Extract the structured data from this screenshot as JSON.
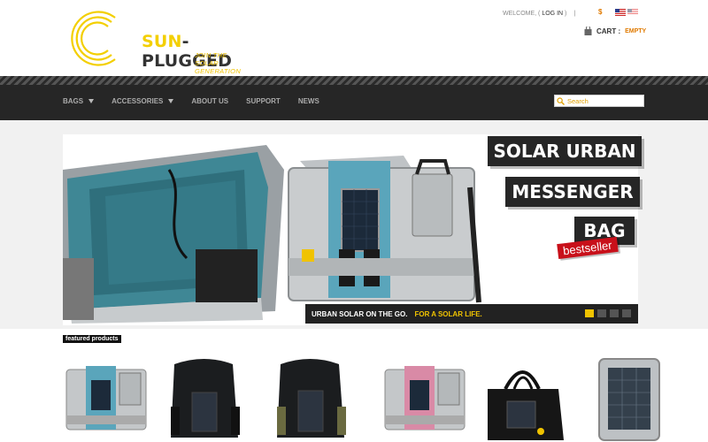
{
  "header": {
    "logo_text_left": "SUN",
    "logo_text_right": "-PLUGGED",
    "logo_tagline": "JOIN THE SOLAR GENERATION",
    "welcome": "WELCOME, (",
    "login": "LOG IN",
    "welcome_close": ")",
    "separator": "|",
    "currency": "$",
    "cart_label": "CART :",
    "cart_status": "EMPTY"
  },
  "nav": {
    "items": [
      {
        "label": "BAGS",
        "has_dropdown": true
      },
      {
        "label": "ACCESSORIES",
        "has_dropdown": true
      },
      {
        "label": "ABOUT US",
        "has_dropdown": false
      },
      {
        "label": "SUPPORT",
        "has_dropdown": false
      },
      {
        "label": "NEWS",
        "has_dropdown": false
      }
    ],
    "search_placeholder": "Search"
  },
  "hero": {
    "headline_1": "SOLAR URBAN",
    "headline_2": "MESSENGER",
    "headline_3": "BAG",
    "badge": "bestseller",
    "caption_main": "URBAN SOLAR ON THE GO.",
    "caption_accent": "FOR A SOLAR LIFE.",
    "slides": 4,
    "active_slide": 1
  },
  "featured": {
    "label": "featured products",
    "products": [
      {
        "icon": "blue-messenger-bag"
      },
      {
        "icon": "black-backpack"
      },
      {
        "icon": "black-backpack"
      },
      {
        "icon": "pink-messenger-bag"
      },
      {
        "icon": "black-tote-bag"
      },
      {
        "icon": "silver-solar-panel-case"
      }
    ]
  },
  "colors": {
    "brand_yellow": "#f0c300",
    "nav_bg": "#262626",
    "accent_orange": "#e07a00",
    "badge_red": "#c8101a"
  }
}
